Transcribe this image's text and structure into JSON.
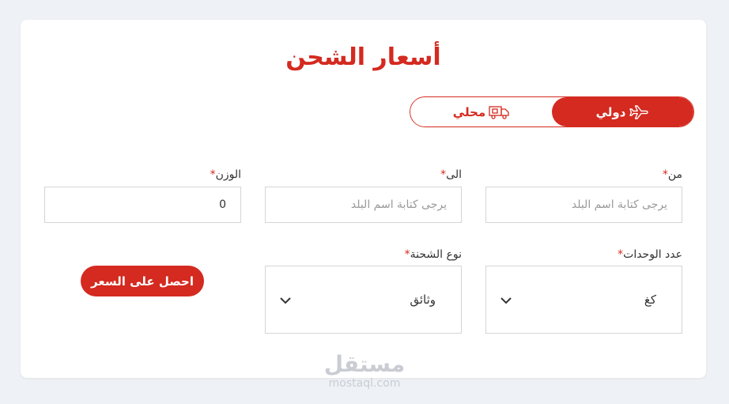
{
  "header": {
    "title": "أسعار الشحن"
  },
  "shipping_toggle": {
    "international_label": "دولي",
    "local_label": "محلي",
    "selected": "international"
  },
  "form": {
    "from": {
      "label": "من",
      "required_mark": "*",
      "placeholder": "يرجى كتابة اسم البلد"
    },
    "to": {
      "label": "الى",
      "required_mark": "*",
      "placeholder": "يرجى كتابة اسم البلد"
    },
    "weight": {
      "label": "الوزن",
      "required_mark": "*",
      "value": "0"
    },
    "units": {
      "label": "عدد الوحدات",
      "required_mark": "*",
      "selected": "كغ"
    },
    "shipment_type": {
      "label": "نوع الشحنة",
      "required_mark": "*",
      "selected": "وثائق"
    }
  },
  "actions": {
    "get_price_label": "احصل على السعر"
  },
  "watermark": {
    "arabic": "مستقل",
    "latin": "mostaql.com"
  },
  "colors": {
    "accent": "#d42a20",
    "background": "#eef1f5",
    "card": "#ffffff",
    "border": "#d5d5d5"
  },
  "icons": {
    "international": "airplane-icon",
    "local": "truck-icon",
    "select": "chevron-down-icon"
  }
}
